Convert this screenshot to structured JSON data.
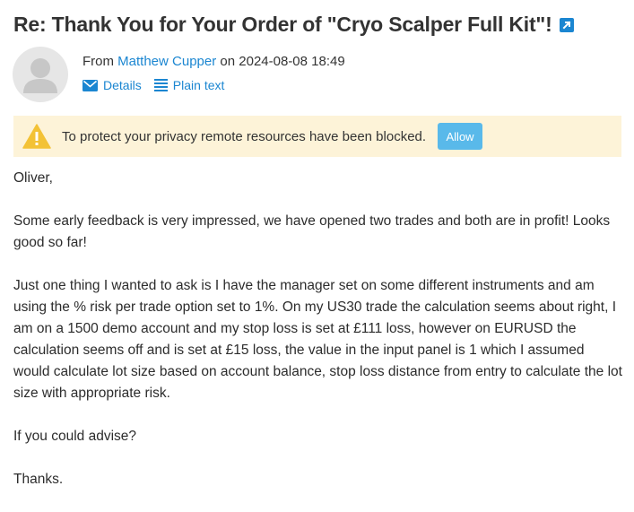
{
  "message": {
    "subject": "Re: Thank You for Your Order of \"Cryo Scalper Full Kit\"!",
    "from_label": "From",
    "sender_name": "Matthew Cupper",
    "date_prefix": "on",
    "date": "2024-08-08 18:49"
  },
  "header_links": {
    "details": "Details",
    "plain_text": "Plain text"
  },
  "privacy_banner": {
    "text": "To protect your privacy remote resources have been blocked.",
    "allow_label": "Allow"
  },
  "body": {
    "paragraphs": [
      "Oliver,",
      "Some early feedback is very impressed, we have opened two trades and both are in profit! Looks good so far!",
      "Just one thing I wanted to ask is I have the manager set on some different instruments and am using the % risk per trade option set to 1%. On my US30 trade the calculation seems about right, I am on a 1500 demo account and my stop loss is set at £111 loss, however on EURUSD the calculation seems off and is set at £15 loss, the value in the input panel is 1 which I assumed would calculate lot size based on account balance, stop loss distance from entry to calculate the lot size with appropriate risk.",
      "If you could advise?",
      "Thanks."
    ]
  },
  "colors": {
    "link": "#1b86d1",
    "banner_bg": "#fdf3d8",
    "allow_button": "#59b9ea",
    "warning": "#f3c236"
  },
  "icons": {
    "open_external": "open-in-new-window-icon",
    "avatar": "user-avatar-icon",
    "details": "envelope-icon",
    "plain_text": "lines-icon",
    "warning": "warning-triangle-icon"
  }
}
